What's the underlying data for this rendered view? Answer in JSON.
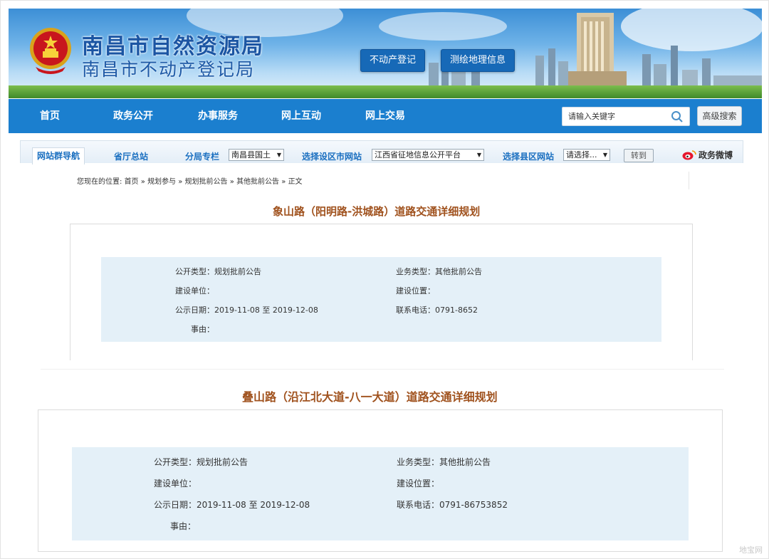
{
  "header": {
    "title_main": "南昌市自然资源局",
    "title_sub": "南昌市不动产登记局",
    "buttons": [
      "不动产登记",
      "测绘地理信息"
    ]
  },
  "nav": {
    "items": [
      "首页",
      "政务公开",
      "办事服务",
      "网上互动",
      "网上交易"
    ],
    "search_placeholder": "请输入关键字",
    "advanced_search": "高级搜索"
  },
  "subnav": {
    "active_tab": "网站群导航",
    "link_province": "省厅总站",
    "link_branch": "分局专栏",
    "select_branch": "南昌县国土",
    "link_district": "选择设区市网站",
    "select_district": "江西省征地信息公开平台",
    "link_county": "选择县区网站",
    "select_county": "请选择...",
    "go": "转到",
    "weibo": "政务微博"
  },
  "breadcrumb": {
    "prefix": "您现在的位置:",
    "items": [
      "首页",
      "规划参与",
      "规划批前公告",
      "其他批前公告",
      "正文"
    ],
    "separator": "»"
  },
  "articles": [
    {
      "title": "象山路（阳明路-洪城路）道路交通详细规划",
      "public_type_label": "公开类型：",
      "public_type": "规划批前公告",
      "business_type_label": "业务类型：",
      "business_type": "其他批前公告",
      "builder_label": "建设单位：",
      "builder": "",
      "location_label": "建设位置：",
      "location": "",
      "date_label": "公示日期：",
      "date_range": "2019-11-08 至 2019-12-08",
      "phone_label": "联系电话：",
      "phone": "0791-8652",
      "reason_label": "事由："
    },
    {
      "title": "叠山路（沿江北大道-八一大道）道路交通详细规划",
      "public_type_label": "公开类型：",
      "public_type": "规划批前公告",
      "business_type_label": "业务类型：",
      "business_type": "其他批前公告",
      "builder_label": "建设单位：",
      "builder": "",
      "location_label": "建设位置：",
      "location": "",
      "date_label": "公示日期：",
      "date_range": "2019-11-08 至 2019-12-08",
      "phone_label": "联系电话：",
      "phone": "0791-86753852",
      "reason_label": "事由："
    }
  ],
  "watermark": "地宝网",
  "colors": {
    "nav_blue": "#1b7fcf",
    "title_brown": "#a0521e",
    "info_bg": "#e4f0f8",
    "banner_button": "#1769b7"
  }
}
